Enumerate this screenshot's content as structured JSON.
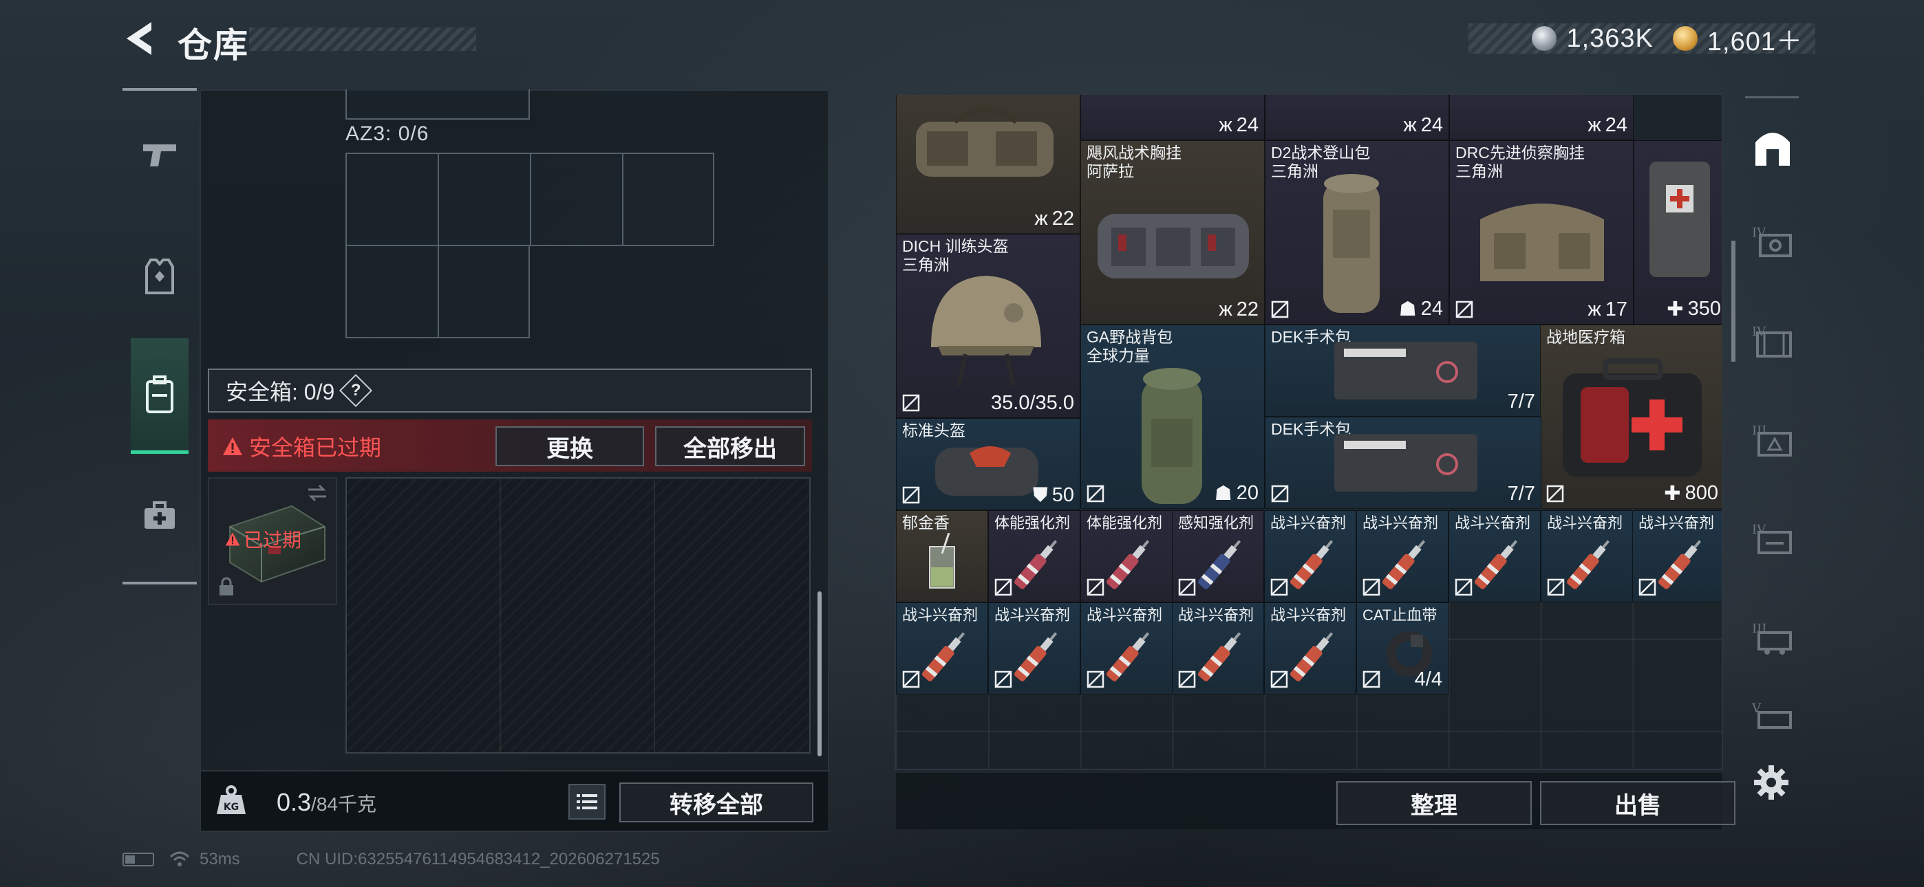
{
  "header": {
    "title": "仓库",
    "currencies": [
      {
        "icon": "silver-coin-icon",
        "value": "1,363K"
      },
      {
        "icon": "gold-coin-icon",
        "value": "1,601＋"
      }
    ]
  },
  "left_sidebar": {
    "items": [
      {
        "icon": "pistol-icon",
        "active": false
      },
      {
        "icon": "armor-vest-icon",
        "active": false
      },
      {
        "icon": "backpack-icon",
        "active": true
      },
      {
        "icon": "medkit-icon",
        "active": false
      }
    ]
  },
  "loadout": {
    "az3_label": "AZ3: 0/6",
    "safe_box": {
      "label": "安全箱: 0/9",
      "help": "?",
      "expired_warning": "安全箱已过期",
      "replace_button": "更换",
      "move_all_out_button": "全部移出",
      "expired_badge": "已过期"
    },
    "weight": {
      "current": "0.3",
      "max": "/84千克"
    },
    "transfer_all_button": "转移全部"
  },
  "stash": {
    "items": [
      {
        "name": "",
        "value": "22",
        "value_icon": "vest-icon",
        "rarity": "gold"
      },
      {
        "name": "",
        "value": "24",
        "value_icon": "vest-icon",
        "rarity": "gold"
      },
      {
        "name": "",
        "value": "24",
        "value_icon": "vest-icon",
        "rarity": "purple"
      },
      {
        "name": "",
        "value": "24",
        "value_icon": "vest-icon",
        "rarity": "purple"
      },
      {
        "name": "飓风战术胸挂\n阿萨拉",
        "value": "22",
        "value_icon": "vest-icon",
        "rarity": "gold"
      },
      {
        "name": "D2战术登山包\n三角洲",
        "value": "24",
        "value_icon": "backpack-icon",
        "rarity": "purple"
      },
      {
        "name": "DRC先进侦察胸挂\n三角洲",
        "value": "17",
        "value_icon": "vest-icon",
        "rarity": "purple"
      },
      {
        "name": "",
        "value": "350",
        "value_icon": "medical-icon",
        "rarity": "purple"
      },
      {
        "name": "DICH 训练头盔\n三角洲",
        "value": "35.0/35.0",
        "value_icon": "",
        "rarity": "purple"
      },
      {
        "name": "GA野战背包\n全球力量",
        "value": "20",
        "value_icon": "backpack-icon",
        "rarity": "blue"
      },
      {
        "name": "DEK手术包",
        "value": "7/7",
        "value_icon": "",
        "rarity": "blue"
      },
      {
        "name": "战地医疗箱",
        "value": "800",
        "value_icon": "medical-icon",
        "rarity": "gold"
      },
      {
        "name": "标准头盔",
        "value": "50",
        "value_icon": "shield-icon",
        "rarity": "blue"
      },
      {
        "name": "DEK手术包",
        "value": "7/7",
        "value_icon": "",
        "rarity": "blue"
      },
      {
        "name": "郁金香",
        "value": "",
        "value_icon": "",
        "rarity": "gold"
      },
      {
        "name": "体能强化剂",
        "value": "",
        "value_icon": "",
        "rarity": "purple"
      },
      {
        "name": "体能强化剂",
        "value": "",
        "value_icon": "",
        "rarity": "purple"
      },
      {
        "name": "感知强化剂",
        "value": "",
        "value_icon": "",
        "rarity": "purple"
      },
      {
        "name": "战斗兴奋剂",
        "value": "",
        "value_icon": "",
        "rarity": "blue"
      },
      {
        "name": "战斗兴奋剂",
        "value": "",
        "value_icon": "",
        "rarity": "blue"
      },
      {
        "name": "战斗兴奋剂",
        "value": "",
        "value_icon": "",
        "rarity": "blue"
      },
      {
        "name": "战斗兴奋剂",
        "value": "",
        "value_icon": "",
        "rarity": "blue"
      },
      {
        "name": "战斗兴奋剂",
        "value": "",
        "value_icon": "",
        "rarity": "blue"
      },
      {
        "name": "战斗兴奋剂",
        "value": "",
        "value_icon": "",
        "rarity": "blue"
      },
      {
        "name": "战斗兴奋剂",
        "value": "",
        "value_icon": "",
        "rarity": "blue"
      },
      {
        "name": "战斗兴奋剂",
        "value": "",
        "value_icon": "",
        "rarity": "blue"
      },
      {
        "name": "战斗兴奋剂",
        "value": "",
        "value_icon": "",
        "rarity": "blue"
      },
      {
        "name": "战斗兴奋剂",
        "value": "",
        "value_icon": "",
        "rarity": "blue"
      },
      {
        "name": "CAT止血带",
        "value": "4/4",
        "value_icon": "",
        "rarity": "blue"
      }
    ],
    "sort_button": "整理",
    "sell_button": "出售"
  },
  "right_sidebar": {
    "items": [
      {
        "icon": "all-items-icon",
        "active": true
      },
      {
        "icon": "tier-iv-category-icon"
      },
      {
        "icon": "tier-iv-category-icon"
      },
      {
        "icon": "tier-iii-category-icon"
      },
      {
        "icon": "tier-iv-category-icon"
      },
      {
        "icon": "tier-iii-category-icon"
      },
      {
        "icon": "tier-v-category-icon"
      }
    ],
    "settings_icon": "gear-icon"
  },
  "status_bar": {
    "ping": "53ms",
    "uid": "CN UID:63255476114954683412_202606271525"
  },
  "colors": {
    "accent_green": "#34d39a",
    "warning_red": "#ff5454",
    "rarity_gold": "#3e3a32",
    "rarity_purple": "#2a2a3b",
    "rarity_blue": "#1f3546"
  }
}
